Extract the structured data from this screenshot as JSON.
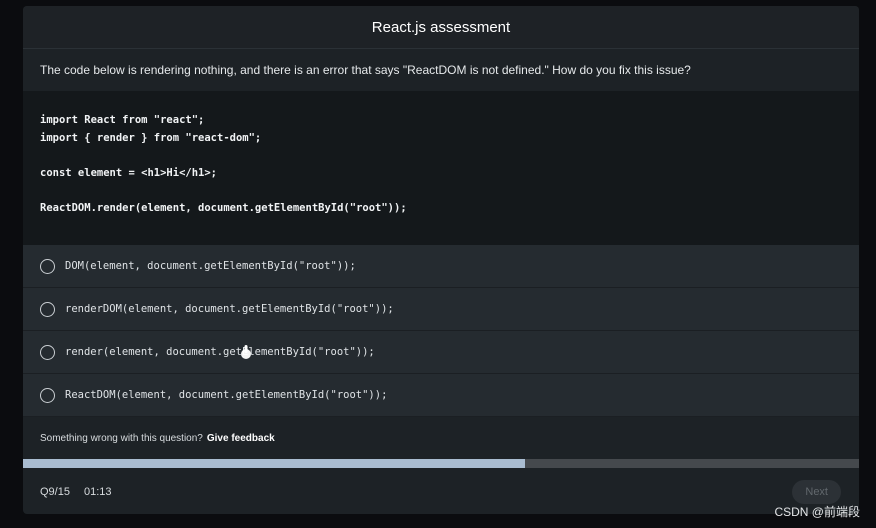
{
  "header": {
    "title": "React.js assessment"
  },
  "question": {
    "text": "The code below is rendering nothing, and there is an error that says \"ReactDOM is not defined.\" How do you fix this issue?"
  },
  "code": {
    "lines": [
      "import React from \"react\";",
      "import { render } from \"react-dom\";",
      "",
      "const element = <h1>Hi</h1>;",
      "",
      "ReactDOM.render(element, document.getElementById(\"root\"));"
    ]
  },
  "options": [
    {
      "label": "DOM(element, document.getElementById(\"root\"));",
      "selected": false
    },
    {
      "label": "renderDOM(element, document.getElementById(\"root\"));",
      "selected": false
    },
    {
      "label": "render(element, document.getElementById(\"root\"));",
      "selected": false
    },
    {
      "label": "ReactDOM(element, document.getElementById(\"root\"));",
      "selected": false
    }
  ],
  "feedback": {
    "prompt": "Something wrong with this question?",
    "link_label": "Give feedback"
  },
  "progress": {
    "fraction": 0.6
  },
  "footer": {
    "question_counter": "Q9/15",
    "timer": "01:13",
    "next_label": "Next"
  },
  "watermark": "CSDN @前端段",
  "colors": {
    "background": "#0b0c0f",
    "card": "#1d2226",
    "code_bg": "#14181b",
    "option_bg": "#252b30",
    "progress_fill": "#a9bcd0",
    "progress_track": "#45494d"
  }
}
